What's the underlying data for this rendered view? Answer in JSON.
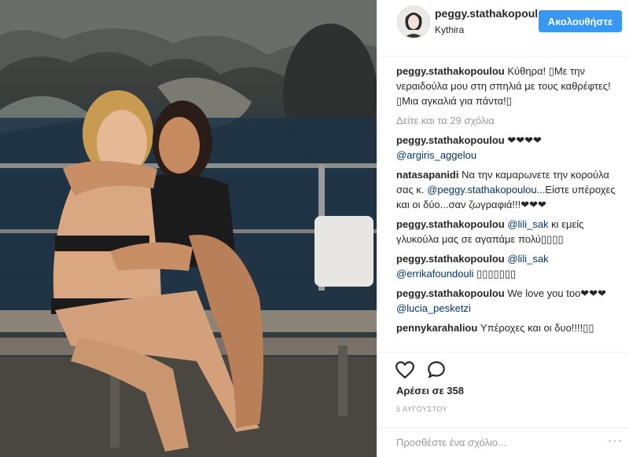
{
  "post": {
    "username": "peggy.stathakopoulou",
    "location": "Kythira",
    "follow_label": "Ακολουθήστε",
    "caption_user": "peggy.stathakopoulou",
    "caption_text": "Κύθηρα! ▯Με την νεραιδούλα μου στη σπηλιά με τους καθρέφτες!▯Μια αγκαλιά για πάντα!▯",
    "view_comments": "Δείτε και τα 29 σχόλια",
    "likes": "Αρέσει σε 358",
    "date": "5 ΑΥΓΟΥΣΤΟΥ",
    "add_comment_placeholder": "Προσθέστε ένα σχόλιο...",
    "more_options": "···"
  },
  "comments": [
    {
      "user": "peggy.stathakopoulou",
      "text": " ❤❤❤❤ ",
      "mention": "@argiris_aggelou",
      "after": ""
    },
    {
      "user": "natasapanidi",
      "text": " Να την καμαρωνετε την κορούλα σας κ. ",
      "mention": "@peggy.stathakopoulou",
      "after": "...Είστε υπέροχες και οι δύο...σαν ζωγραφιά!!!❤❤❤"
    },
    {
      "user": "peggy.stathakopoulou",
      "text": " ",
      "mention": "@lili_sak",
      "after": " κι εμείς γλυκούλα μας σε αγαπάμε πολύ▯▯▯▯"
    },
    {
      "user": "peggy.stathakopoulou",
      "text": " ",
      "mention": "@lili_sak",
      "after": " ",
      "mention2": "@errikafoundouli",
      "after2": " ▯▯▯▯▯▯▯"
    },
    {
      "user": "peggy.stathakopoulou",
      "text": " We love you too❤❤❤",
      "mention": "@lucia_pesketzi",
      "after": ""
    },
    {
      "user": "pennykarahaliou",
      "text": " Υπέροχες και οι δυο!!!!▯▯",
      "mention": "",
      "after": ""
    }
  ],
  "icons": {
    "like": "heart-icon",
    "comment": "comment-bubble-icon",
    "avatar": "profile-avatar"
  },
  "colors": {
    "follow_button": "#3897f0",
    "mention": "#003569",
    "muted": "#999999",
    "border": "#efefef"
  }
}
